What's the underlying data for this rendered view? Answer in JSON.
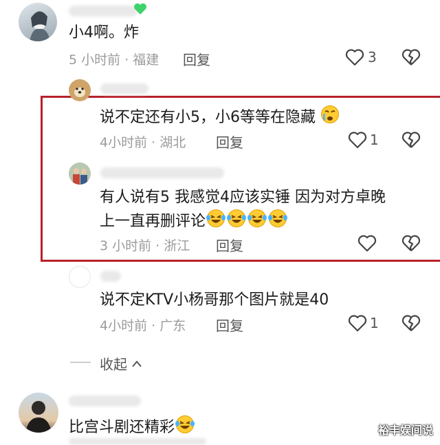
{
  "comments": [
    {
      "text": "小4啊。炸",
      "meta": "5 小时前 · 福建",
      "reply": "回复",
      "likes": "3"
    },
    {
      "text": "说不定还有小5，小6等等在隐藏",
      "meta": "4小时前 · 湖北",
      "reply": "回复",
      "likes": "1"
    },
    {
      "text_line1": "有人说有5 我感觉4应该实锤 因为对方卓晚",
      "text_line2": "上一直再删评论",
      "meta": "3 小时前 · 浙江",
      "reply": "回复"
    },
    {
      "text": "说不定KTV小杨哥那个图片就是40",
      "meta": "4小时前 · 广东",
      "reply": "回复",
      "likes": "1"
    },
    {
      "text": "比宫斗剧还精彩"
    }
  ],
  "collapse_label": "收起",
  "watermark": "裕丰娱间说",
  "colors": {
    "highlight_border": "#b8202a",
    "meta_text": "#9b9b9b"
  },
  "icons": [
    "heart-icon",
    "broken-heart-icon",
    "chevron-up-icon",
    "laughing-crying-emoji",
    "crying-emoji"
  ]
}
